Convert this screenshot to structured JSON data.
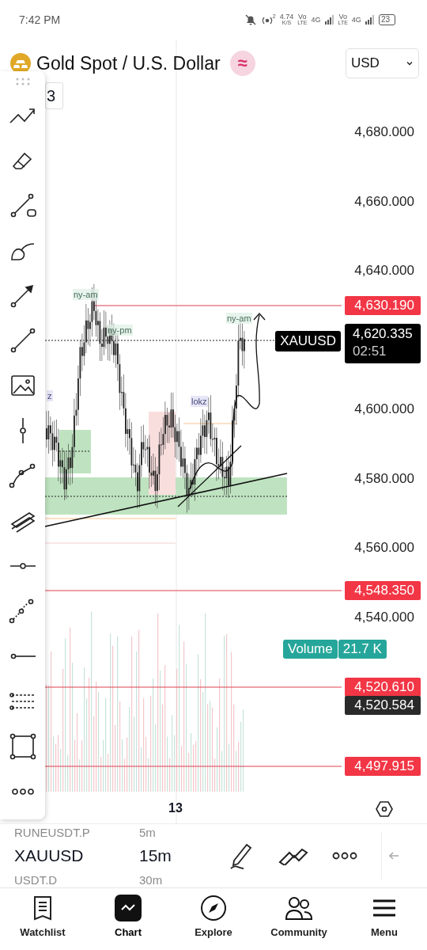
{
  "status_bar": {
    "time": "7:42 PM",
    "hotspot_badge": "2",
    "net_speed": "4.74",
    "net_unit": "K/S",
    "sims": [
      {
        "vo": "Vo",
        "lte": "LTE",
        "net": "4G"
      },
      {
        "vo": "Vo",
        "lte": "LTE",
        "net": "4G"
      }
    ],
    "battery": "23"
  },
  "header": {
    "title": "Gold Spot / U.S. Dollar",
    "badge": "≈",
    "currency": "USD",
    "tab_peek": "3"
  },
  "chart": {
    "price_axis": [
      "4,680.000",
      "4,660.000",
      "4,640.000",
      "4,600.000",
      "4,580.000",
      "4,560.000",
      "4,540.000"
    ],
    "level_lines": [
      "4,630.190",
      "4,548.350",
      "4,520.610",
      "4,497.915"
    ],
    "last_price": {
      "symbol": "XAUUSD",
      "price": "4,620.335",
      "countdown": "02:51"
    },
    "crosshair_price": "4,520.584",
    "volume": {
      "label": "Volume",
      "value": "21.7 K"
    },
    "session_labels": [
      "ny-am",
      "ny-pm",
      "z",
      "lokz",
      "ny-am"
    ],
    "x_axis": [
      "13"
    ]
  },
  "symbol_picker": [
    {
      "symbol": "RUNEUSDT.P",
      "interval": "5m",
      "selected": false
    },
    {
      "symbol": "XAUUSD",
      "interval": "15m",
      "selected": true
    },
    {
      "symbol": "USDT.D",
      "interval": "30m",
      "selected": false
    }
  ],
  "nav": [
    {
      "label": "Watchlist",
      "selected": false
    },
    {
      "label": "Chart",
      "selected": true
    },
    {
      "label": "Explore",
      "selected": false
    },
    {
      "label": "Community",
      "selected": false
    },
    {
      "label": "Menu",
      "selected": false
    }
  ]
}
